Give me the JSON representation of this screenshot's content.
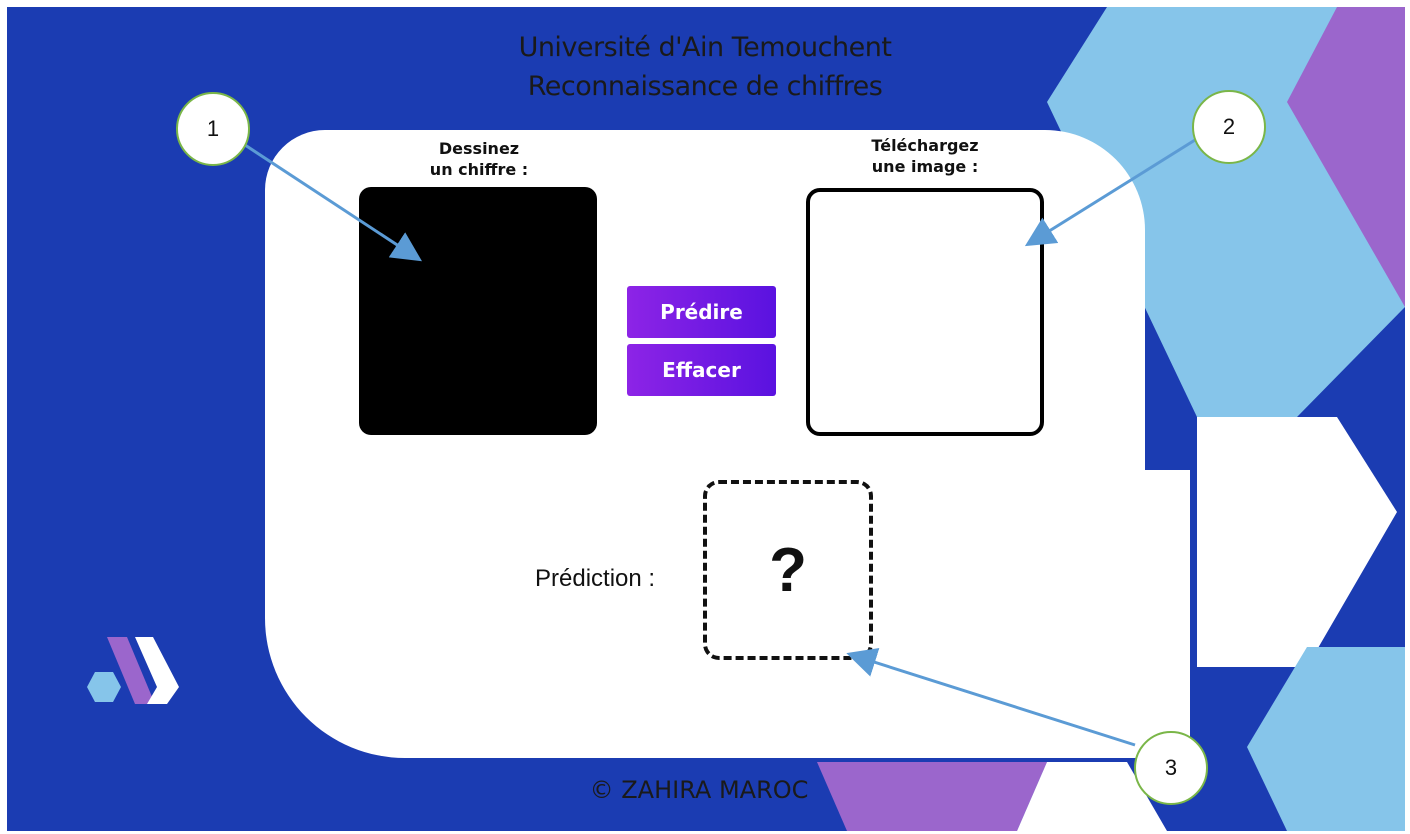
{
  "header": {
    "title_line1": "Université d'Ain Temouchent",
    "title_line2": "Reconnaissance de chiffres"
  },
  "draw_panel": {
    "label_line1": "Dessinez",
    "label_line2": "un chiffre :"
  },
  "upload_panel": {
    "label_line1": "Téléchargez",
    "label_line2": "une image :"
  },
  "buttons": {
    "predict_label": "Prédire",
    "clear_label": "Effacer",
    "gradient_start": "#8d24e6",
    "gradient_end": "#5a12e0"
  },
  "prediction": {
    "label": "Prédiction :",
    "value": "?"
  },
  "footer": {
    "copyright": "© ZAHIRA MAROC"
  },
  "callouts": [
    {
      "number": "1"
    },
    {
      "number": "2"
    },
    {
      "number": "3"
    }
  ],
  "colors": {
    "background": "#1b3cb2",
    "light_blue": "#86c5ea",
    "purple": "#9b66cc",
    "arrow": "#5b9bd5",
    "callout_border": "#7ab648"
  }
}
